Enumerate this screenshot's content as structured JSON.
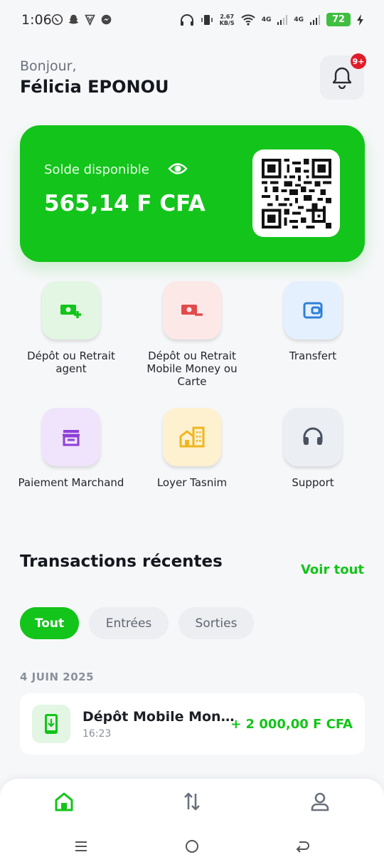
{
  "status_bar": {
    "time": "1:06",
    "net_speed_value": "2.67",
    "net_speed_unit": "KB/S",
    "network_1": "4G",
    "network_2": "4G",
    "battery": "72"
  },
  "header": {
    "greeting": "Bonjour,",
    "user_name": "Félicia EPONOU",
    "notification_badge": "9+"
  },
  "balance": {
    "label": "Solde disponible",
    "value": "565,14 F CFA"
  },
  "actions": [
    {
      "label": "Dépôt ou Retrait agent",
      "icon": "cash-plus-icon",
      "tile_bg": "#e2f6e3",
      "icon_color": "#13c41a"
    },
    {
      "label": "Dépôt ou Retrait Mobile Money ou Carte",
      "icon": "cash-minus-icon",
      "tile_bg": "#fde8e8",
      "icon_color": "#e24b4b"
    },
    {
      "label": "Transfert",
      "icon": "wallet-icon",
      "tile_bg": "#e4f0fd",
      "icon_color": "#2f7fd8"
    },
    {
      "label": "Paiement Marchand",
      "icon": "store-icon",
      "tile_bg": "#efe4fb",
      "icon_color": "#8e3fd6"
    },
    {
      "label": "Loyer Tasnim",
      "icon": "buildings-icon",
      "tile_bg": "#fdf1cf",
      "icon_color": "#f0b51e"
    },
    {
      "label": "Support",
      "icon": "headset-icon",
      "tile_bg": "#ebeef2",
      "icon_color": "#4a5260"
    }
  ],
  "transactions": {
    "title": "Transactions récentes",
    "see_all": "Voir tout",
    "filters": [
      "Tout",
      "Entrées",
      "Sorties"
    ],
    "active_filter": "Tout",
    "groups": [
      {
        "date": "4 JUIN 2025",
        "items": [
          {
            "title": "Dépôt Mobile Mon...",
            "time": "16:23",
            "amount": "+ 2 000,00 F CFA",
            "icon": "phone-download-icon"
          }
        ]
      }
    ]
  },
  "bottom_nav": {
    "items": [
      "home-icon",
      "transfer-arrows-icon",
      "profile-icon"
    ],
    "active": "home-icon"
  },
  "colors": {
    "primary": "#13c41a",
    "background": "#f6f7f9",
    "badge": "#e11d2a"
  }
}
